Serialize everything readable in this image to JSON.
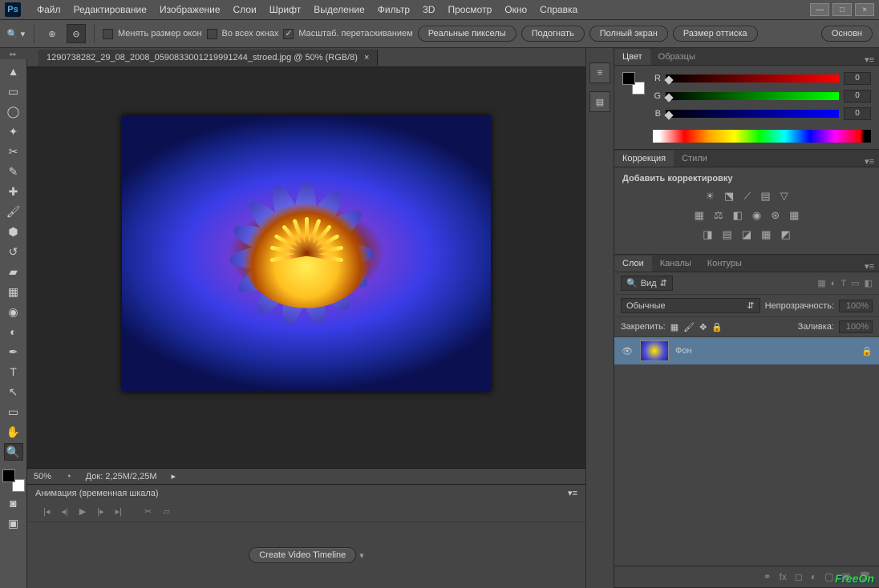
{
  "app": {
    "logo": "Ps"
  },
  "menu": [
    "Файл",
    "Редактирование",
    "Изображение",
    "Слои",
    "Шрифт",
    "Выделение",
    "Фильтр",
    "3D",
    "Просмотр",
    "Окно",
    "Справка"
  ],
  "win": {
    "min": "—",
    "max": "□",
    "close": "×"
  },
  "optbar": {
    "chk1": "Менять размер окон",
    "chk2": "Во всех окнах",
    "chk3": "Масштаб. перетаскиванием",
    "btn1": "Реальные пикселы",
    "btn2": "Подогнать",
    "btn3": "Полный экран",
    "btn4": "Размер оттиска",
    "right": "Основн"
  },
  "doc": {
    "tab": "1290738282_29_08_2008_0590833001219991244_stroed.jpg @ 50% (RGB/8)",
    "zoom": "50%",
    "info": "Док: 2,25M/2,25M"
  },
  "animation": {
    "title": "Анимация (временная шкала)",
    "btn": "Create Video Timeline"
  },
  "color": {
    "tab1": "Цвет",
    "tab2": "Образцы",
    "r": "R",
    "g": "G",
    "b": "B",
    "rv": "0",
    "gv": "0",
    "bv": "0"
  },
  "adj": {
    "tab1": "Коррекция",
    "tab2": "Стили",
    "title": "Добавить корректировку"
  },
  "layers": {
    "tab1": "Слои",
    "tab2": "Каналы",
    "tab3": "Контуры",
    "kind": "Вид",
    "mode": "Обычные",
    "opacity_lbl": "Непрозрачность:",
    "opacity": "100%",
    "lock_lbl": "Закрепить:",
    "fill_lbl": "Заливка:",
    "fill": "100%",
    "layer1": "Фон"
  },
  "watermark": "FreeOn"
}
